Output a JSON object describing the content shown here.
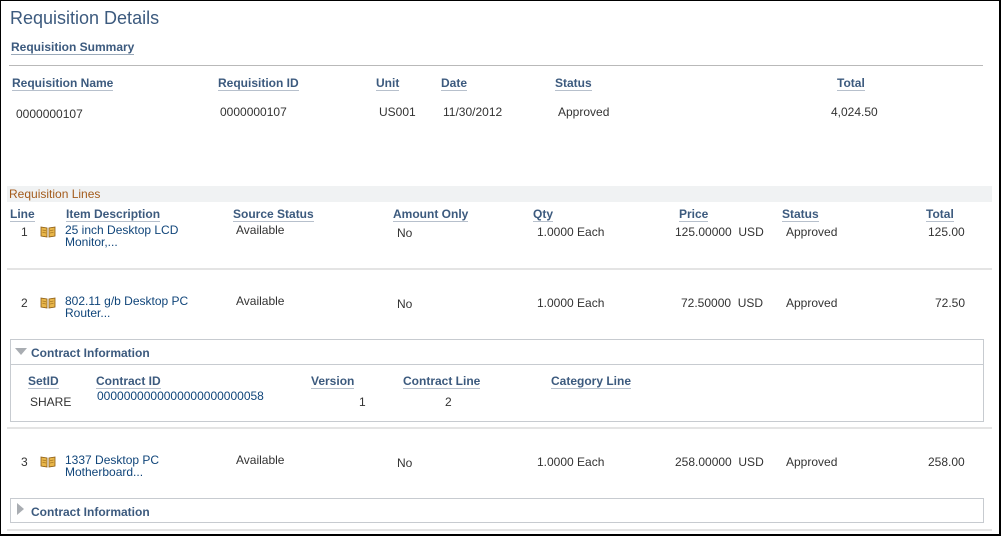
{
  "page": {
    "title": "Requisition Details"
  },
  "summary": {
    "section_label": "Requisition Summary",
    "headers": {
      "name": "Requisition Name",
      "id": "Requisition ID",
      "unit": "Unit",
      "date": "Date",
      "status": "Status",
      "total": "Total"
    },
    "values": {
      "name": "0000000107",
      "id": "0000000107",
      "unit": "US001",
      "date": "11/30/2012",
      "status": "Approved",
      "total": "4,024.50"
    }
  },
  "lines": {
    "section_label": "Requisition Lines",
    "headers": {
      "line": "Line",
      "item": "Item Description",
      "source_status": "Source Status",
      "amount_only": "Amount Only",
      "qty": "Qty",
      "price": "Price",
      "status": "Status",
      "total": "Total"
    },
    "rows": [
      {
        "line": "1",
        "icon": "book-icon",
        "item": "25 inch Desktop LCD Monitor,...",
        "source_status": "Available",
        "amount_only": "No",
        "qty": "1.0000 Each",
        "price": "125.00000  USD",
        "status": "Approved",
        "total": "125.00"
      },
      {
        "line": "2",
        "icon": "book-icon",
        "item": "802.11 g/b Desktop PC Router...",
        "source_status": "Available",
        "amount_only": "No",
        "qty": "1.0000 Each",
        "price": "72.50000  USD",
        "status": "Approved",
        "total": "72.50"
      },
      {
        "line": "3",
        "icon": "book-icon",
        "item": "1337 Desktop PC Motherboard...",
        "source_status": "Available",
        "amount_only": "No",
        "qty": "1.0000 Each",
        "price": "258.00000  USD",
        "status": "Approved",
        "total": "258.00"
      }
    ]
  },
  "contract_info": {
    "label": "Contract Information",
    "headers": {
      "setid": "SetID",
      "contract_id": "Contract ID",
      "version": "Version",
      "contract_line": "Contract Line",
      "category_line": "Category Line"
    },
    "line2": {
      "expanded": true,
      "setid": "SHARE",
      "contract_id": "0000000000000000000000058",
      "version": "1",
      "contract_line": "2",
      "category_line": ""
    },
    "line3": {
      "expanded": false
    }
  },
  "colors": {
    "title": "#3c5a7e",
    "link": "#10457a",
    "section_accent": "#a35b1c",
    "band": "#f0f2f3"
  }
}
